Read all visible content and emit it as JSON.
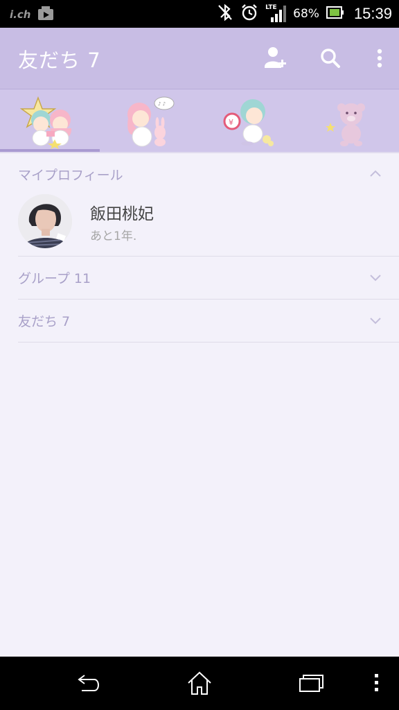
{
  "status_bar": {
    "carrier": "i.ch",
    "network": "LTE",
    "battery_percent": "68%",
    "time": "15:39",
    "icons": [
      "carrier-logo-icon",
      "media-icon",
      "bluetooth-off-icon",
      "alarm-icon",
      "signal-icon",
      "battery-icon"
    ]
  },
  "header": {
    "title": "友だち 7",
    "actions": [
      "add-friend-icon",
      "search-icon",
      "more-vert-icon"
    ]
  },
  "tabs": {
    "items": [
      {
        "name": "tab-character-1",
        "icon": "twin-stars-icon",
        "selected": true
      },
      {
        "name": "tab-character-2",
        "icon": "girl-bunny-icon",
        "selected": false
      },
      {
        "name": "tab-character-3",
        "icon": "boy-clock-icon",
        "selected": false
      },
      {
        "name": "tab-character-4",
        "icon": "bear-icon",
        "selected": false
      }
    ]
  },
  "sections": {
    "my_profile": {
      "label": "マイプロフィール",
      "expanded": true,
      "name": "飯田桃妃",
      "status": "あと1年."
    },
    "groups": {
      "label": "グループ 11",
      "expanded": false
    },
    "friends": {
      "label": "友だち 7",
      "expanded": false
    }
  },
  "colors": {
    "header": "#c8bde4",
    "tabs": "#d0c6ea",
    "indicator": "#a99ad1",
    "background": "#f3f1fa",
    "section_text": "#a8a0c8"
  },
  "nav_bar": {
    "icons": [
      "back-icon",
      "home-icon",
      "recents-icon",
      "menu-icon"
    ]
  }
}
